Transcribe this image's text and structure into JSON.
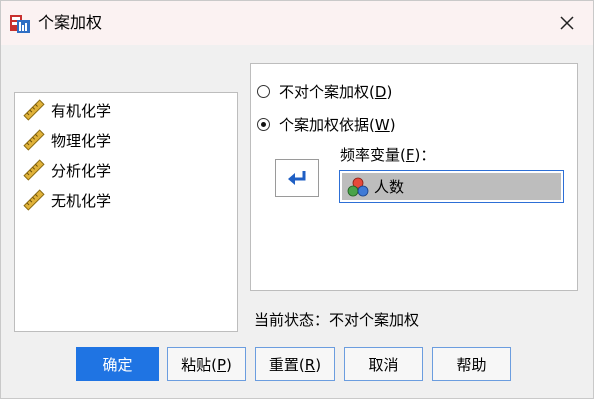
{
  "window": {
    "title": "个案加权"
  },
  "variables": [
    {
      "label": "有机化学",
      "icon": "scale-ruler-icon"
    },
    {
      "label": "物理化学",
      "icon": "scale-ruler-icon"
    },
    {
      "label": "分析化学",
      "icon": "scale-ruler-icon"
    },
    {
      "label": "无机化学",
      "icon": "scale-ruler-icon"
    }
  ],
  "weight": {
    "options": [
      {
        "label_main": "不对个案加权",
        "hotkey": "D",
        "checked": false
      },
      {
        "label_main": "个案加权依据",
        "hotkey": "W",
        "checked": true
      }
    ],
    "freq_label_main": "频率变量",
    "freq_hotkey": "F",
    "freq_value": "人数",
    "freq_icon": "nominal-variable-icon"
  },
  "status": {
    "text": "当前状态：不对个案加权"
  },
  "buttons": {
    "ok": {
      "label": "确定"
    },
    "paste": {
      "label_main": "粘贴",
      "hotkey": "P"
    },
    "reset": {
      "label_main": "重置",
      "hotkey": "R"
    },
    "cancel": {
      "label": "取消"
    },
    "help": {
      "label": "帮助"
    }
  },
  "colors": {
    "primary": "#1f74e3",
    "titlebar": "#fbf2f2",
    "accent_border": "#6b9ddf"
  }
}
